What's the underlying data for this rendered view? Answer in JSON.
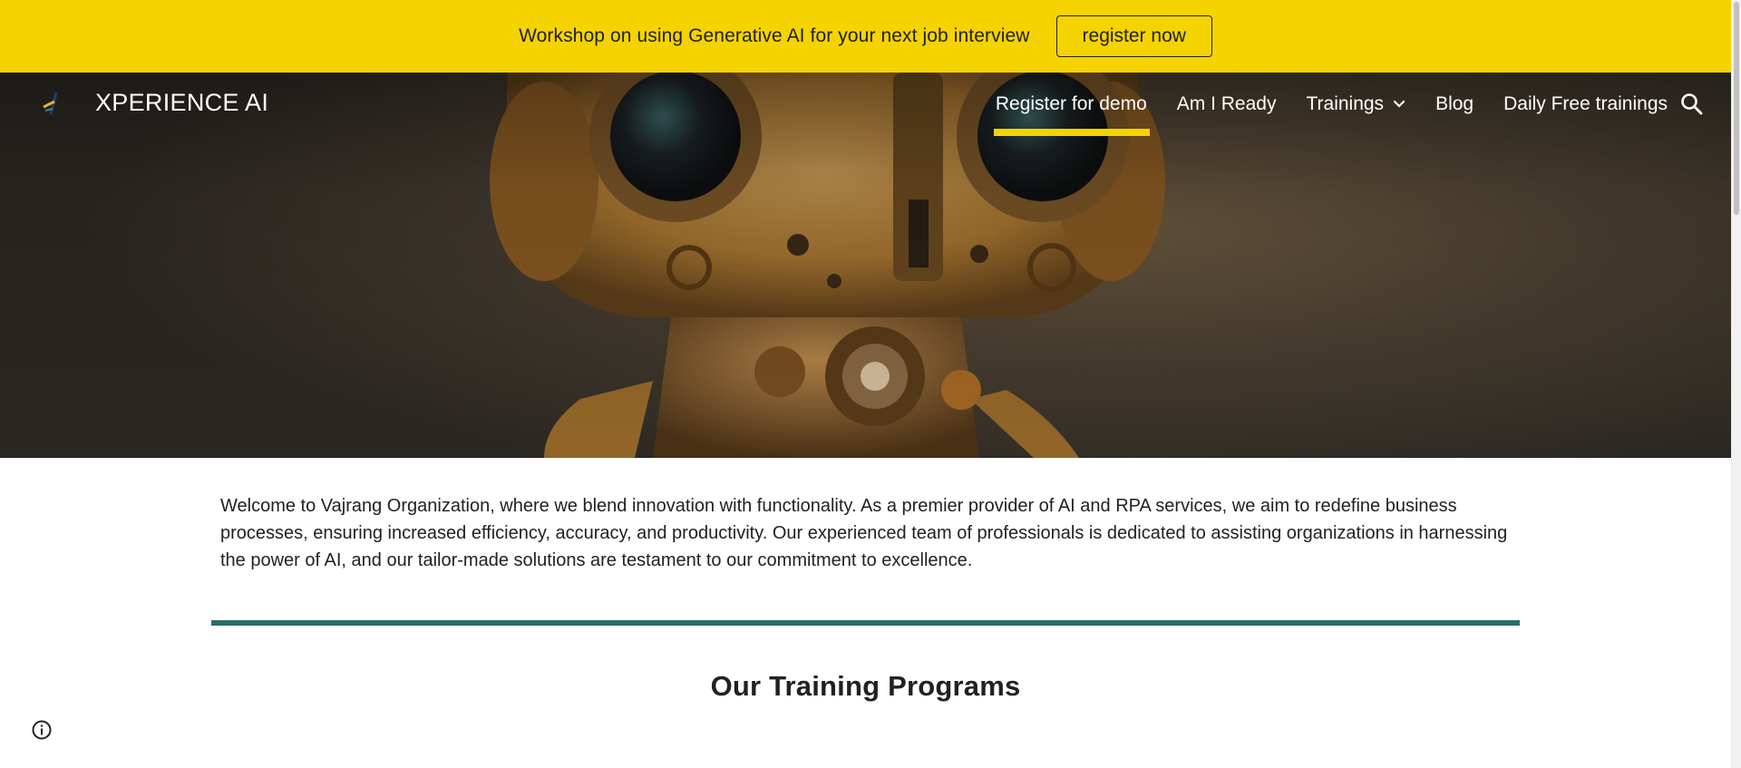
{
  "announcement": {
    "text": "Workshop on using Generative AI for your next job interview",
    "button_label": "register now"
  },
  "header": {
    "site_title": "XPERIENCE AI",
    "nav": [
      {
        "label": "Register for demo",
        "active": true
      },
      {
        "label": "Am I Ready"
      },
      {
        "label": "Trainings",
        "icon": "chevron-down-icon"
      },
      {
        "label": "Blog"
      },
      {
        "label": "Daily Free trainings"
      }
    ],
    "search_icon": "search-icon"
  },
  "hero": {
    "image": "robot-illustration"
  },
  "main": {
    "intro": "Welcome to Vajrang Organization, where we blend innovation with functionality. As a premier provider of AI and RPA services, we aim to redefine business processes, ensuring increased efficiency, accuracy, and productivity. Our experienced team of professionals is dedicated to assisting organizations in harnessing the power of AI, and our tailor-made solutions are testament to our commitment to excellence.",
    "section_title": "Our Training Programs"
  },
  "footer": {
    "info_icon": "info-icon"
  },
  "colors": {
    "accent_yellow": "#f5d300",
    "divider_teal": "#2e6b6b"
  }
}
